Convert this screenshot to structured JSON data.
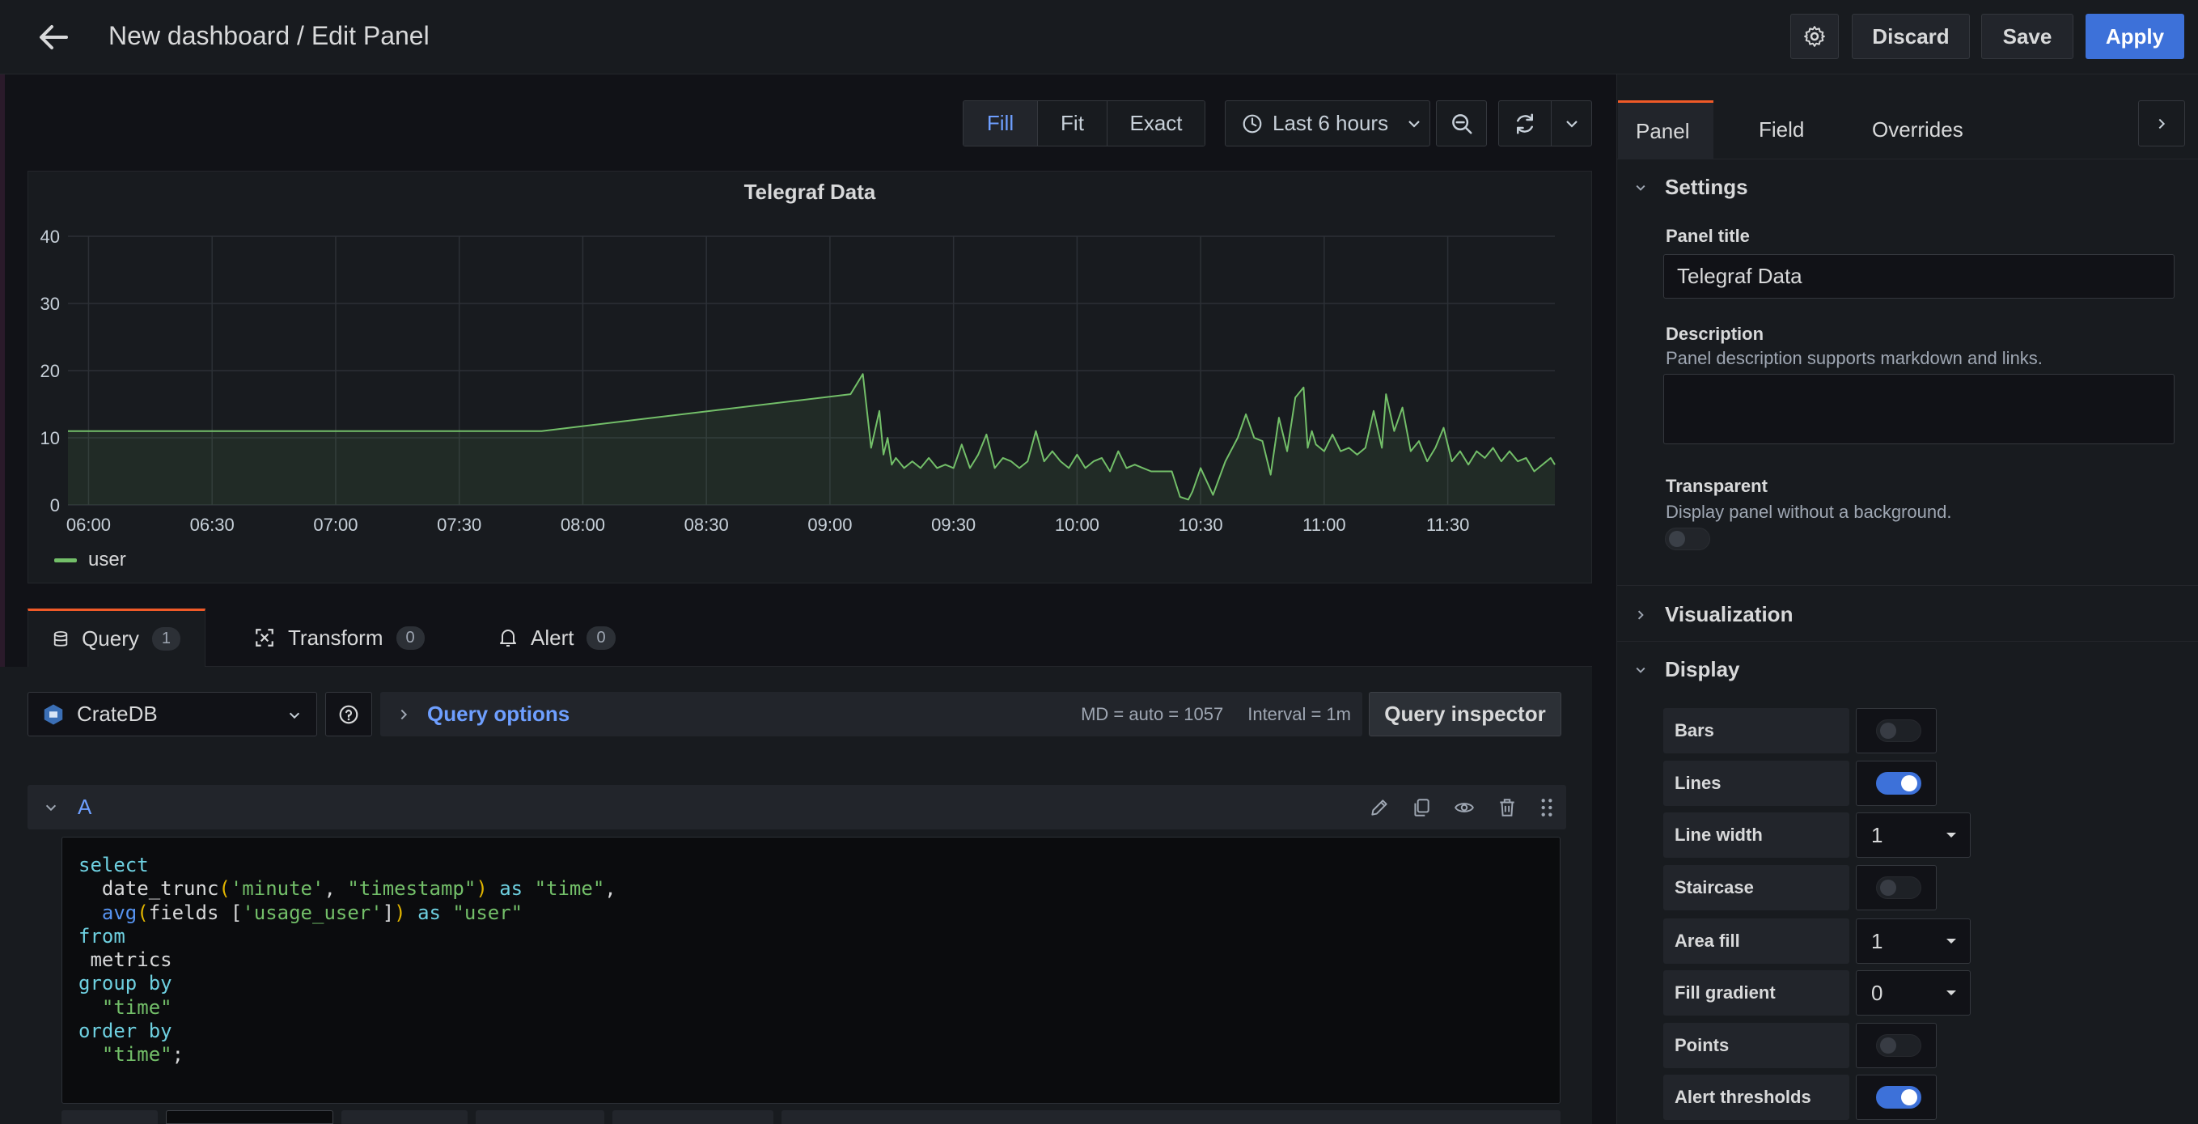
{
  "header": {
    "title": "New dashboard / Edit Panel",
    "discard_label": "Discard",
    "save_label": "Save",
    "apply_label": "Apply"
  },
  "view_modes": [
    "Fill",
    "Fit",
    "Exact"
  ],
  "active_view_mode": "Fill",
  "time_range": "Last 6 hours",
  "chart_data": {
    "type": "line",
    "title": "Telegraf Data",
    "x_ticks": [
      "06:00",
      "06:30",
      "07:00",
      "07:30",
      "08:00",
      "08:30",
      "09:00",
      "09:30",
      "10:00",
      "10:30",
      "11:00",
      "11:30"
    ],
    "y_ticks": [
      0,
      10,
      20,
      30,
      40
    ],
    "ylim": [
      0,
      40
    ],
    "xlim": [
      "05:55",
      "11:56"
    ],
    "grid": true,
    "legend_position": "bottom-left",
    "fill": true,
    "series": [
      {
        "name": "user",
        "color": "#73bf69",
        "x": [
          "05:55",
          "07:50",
          "09:05",
          "09:08",
          "09:10",
          "09:12",
          "09:13",
          "09:14",
          "09:15",
          "09:16",
          "09:18",
          "09:20",
          "09:22",
          "09:24",
          "09:26",
          "09:28",
          "09:30",
          "09:32",
          "09:34",
          "09:36",
          "09:38",
          "09:40",
          "09:42",
          "09:44",
          "09:46",
          "09:48",
          "09:50",
          "09:52",
          "09:54",
          "09:56",
          "09:58",
          "10:00",
          "10:02",
          "10:04",
          "10:06",
          "10:08",
          "10:10",
          "10:12",
          "10:14",
          "10:16",
          "10:18",
          "10:20",
          "10:22",
          "10:23",
          "10:25",
          "10:27",
          "10:28",
          "10:30",
          "10:33",
          "10:36",
          "10:39",
          "10:41",
          "10:43",
          "10:45",
          "10:47",
          "10:49",
          "10:51",
          "10:53",
          "10:55",
          "10:56",
          "10:57",
          "10:58",
          "11:00",
          "11:02",
          "11:04",
          "11:06",
          "11:08",
          "11:10",
          "11:12",
          "11:14",
          "11:15",
          "11:17",
          "11:19",
          "11:21",
          "11:23",
          "11:25",
          "11:27",
          "11:29",
          "11:31",
          "11:33",
          "11:35",
          "11:37",
          "11:39",
          "11:41",
          "11:43",
          "11:45",
          "11:47",
          "11:49",
          "11:51",
          "11:53",
          "11:55",
          "11:56"
        ],
        "y": [
          11,
          11,
          16.5,
          19.5,
          8.5,
          14,
          7.5,
          10,
          6,
          7,
          5.5,
          6.5,
          5.5,
          7,
          5.5,
          6,
          5.5,
          9,
          5.5,
          7.5,
          10.5,
          5.5,
          7,
          6.5,
          5.5,
          6.5,
          11,
          6.5,
          8,
          6.5,
          5.5,
          7.5,
          5.5,
          6.5,
          7,
          5,
          8,
          5.5,
          6,
          5.5,
          5,
          5,
          5,
          5,
          1.2,
          0.8,
          2,
          5.5,
          1.5,
          6.5,
          10,
          13.5,
          10,
          9.5,
          4.5,
          13,
          8,
          16,
          17.5,
          8.5,
          11,
          9,
          8,
          10.5,
          8,
          8.5,
          7.5,
          8.5,
          14,
          8.5,
          16.5,
          11,
          14.5,
          8,
          9.5,
          6.5,
          8.5,
          11.5,
          6.5,
          8,
          6,
          8,
          7,
          8.5,
          6.5,
          8,
          6.5,
          7,
          5,
          6,
          7,
          6
        ]
      }
    ]
  },
  "query_tabs": [
    {
      "label": "Query",
      "count": "1"
    },
    {
      "label": "Transform",
      "count": "0"
    },
    {
      "label": "Alert",
      "count": "0"
    }
  ],
  "datasource": "CrateDB",
  "query_options": {
    "label": "Query options",
    "md": "MD = auto = 1057",
    "interval": "Interval = 1m",
    "inspector_label": "Query inspector"
  },
  "query_row": {
    "ref_id": "A"
  },
  "sql_lines": [
    [
      {
        "t": "select",
        "c": "kw"
      }
    ],
    [
      {
        "t": "  ",
        "c": ""
      },
      {
        "t": "date_trunc",
        "c": ""
      },
      {
        "t": "(",
        "c": "paren"
      },
      {
        "t": "'minute'",
        "c": "str"
      },
      {
        "t": ", ",
        "c": ""
      },
      {
        "t": "\"timestamp\"",
        "c": "str"
      },
      {
        "t": ")",
        "c": "paren"
      },
      {
        "t": " ",
        "c": ""
      },
      {
        "t": "as",
        "c": "kw"
      },
      {
        "t": " ",
        "c": ""
      },
      {
        "t": "\"time\"",
        "c": "str"
      },
      {
        "t": ",",
        "c": ""
      }
    ],
    [
      {
        "t": "  ",
        "c": ""
      },
      {
        "t": "avg",
        "c": "fn"
      },
      {
        "t": "(",
        "c": "paren"
      },
      {
        "t": "fields [",
        "c": ""
      },
      {
        "t": "'usage_user'",
        "c": "str"
      },
      {
        "t": "]",
        "c": ""
      },
      {
        "t": ")",
        "c": "paren"
      },
      {
        "t": " ",
        "c": ""
      },
      {
        "t": "as",
        "c": "kw"
      },
      {
        "t": " ",
        "c": ""
      },
      {
        "t": "\"user\"",
        "c": "str"
      }
    ],
    [
      {
        "t": "from",
        "c": "kw"
      }
    ],
    [
      {
        "t": " metrics",
        "c": ""
      }
    ],
    [
      {
        "t": "group by",
        "c": "kw"
      }
    ],
    [
      {
        "t": "  ",
        "c": ""
      },
      {
        "t": "\"time\"",
        "c": "str"
      }
    ],
    [
      {
        "t": "order by",
        "c": "kw"
      }
    ],
    [
      {
        "t": "  ",
        "c": ""
      },
      {
        "t": "\"time\"",
        "c": "str"
      },
      {
        "t": ";",
        "c": ""
      }
    ]
  ],
  "options_tabs": [
    "Panel",
    "Field",
    "Overrides"
  ],
  "settings": {
    "section_label": "Settings",
    "panel_title_label": "Panel title",
    "panel_title_value": "Telegraf Data",
    "description_label": "Description",
    "description_help": "Panel description supports markdown and links.",
    "description_value": "",
    "transparent_label": "Transparent",
    "transparent_help": "Display panel without a background."
  },
  "visualization_label": "Visualization",
  "display": {
    "section_label": "Display",
    "options": [
      {
        "label": "Bars",
        "kind": "toggle",
        "on": false
      },
      {
        "label": "Lines",
        "kind": "toggle",
        "on": true
      },
      {
        "label": "Line width",
        "kind": "select",
        "value": "1"
      },
      {
        "label": "Staircase",
        "kind": "toggle",
        "on": false
      },
      {
        "label": "Area fill",
        "kind": "select",
        "value": "1"
      },
      {
        "label": "Fill gradient",
        "kind": "select",
        "value": "0"
      },
      {
        "label": "Points",
        "kind": "toggle",
        "on": false
      },
      {
        "label": "Alert thresholds",
        "kind": "toggle",
        "on": true
      }
    ]
  }
}
